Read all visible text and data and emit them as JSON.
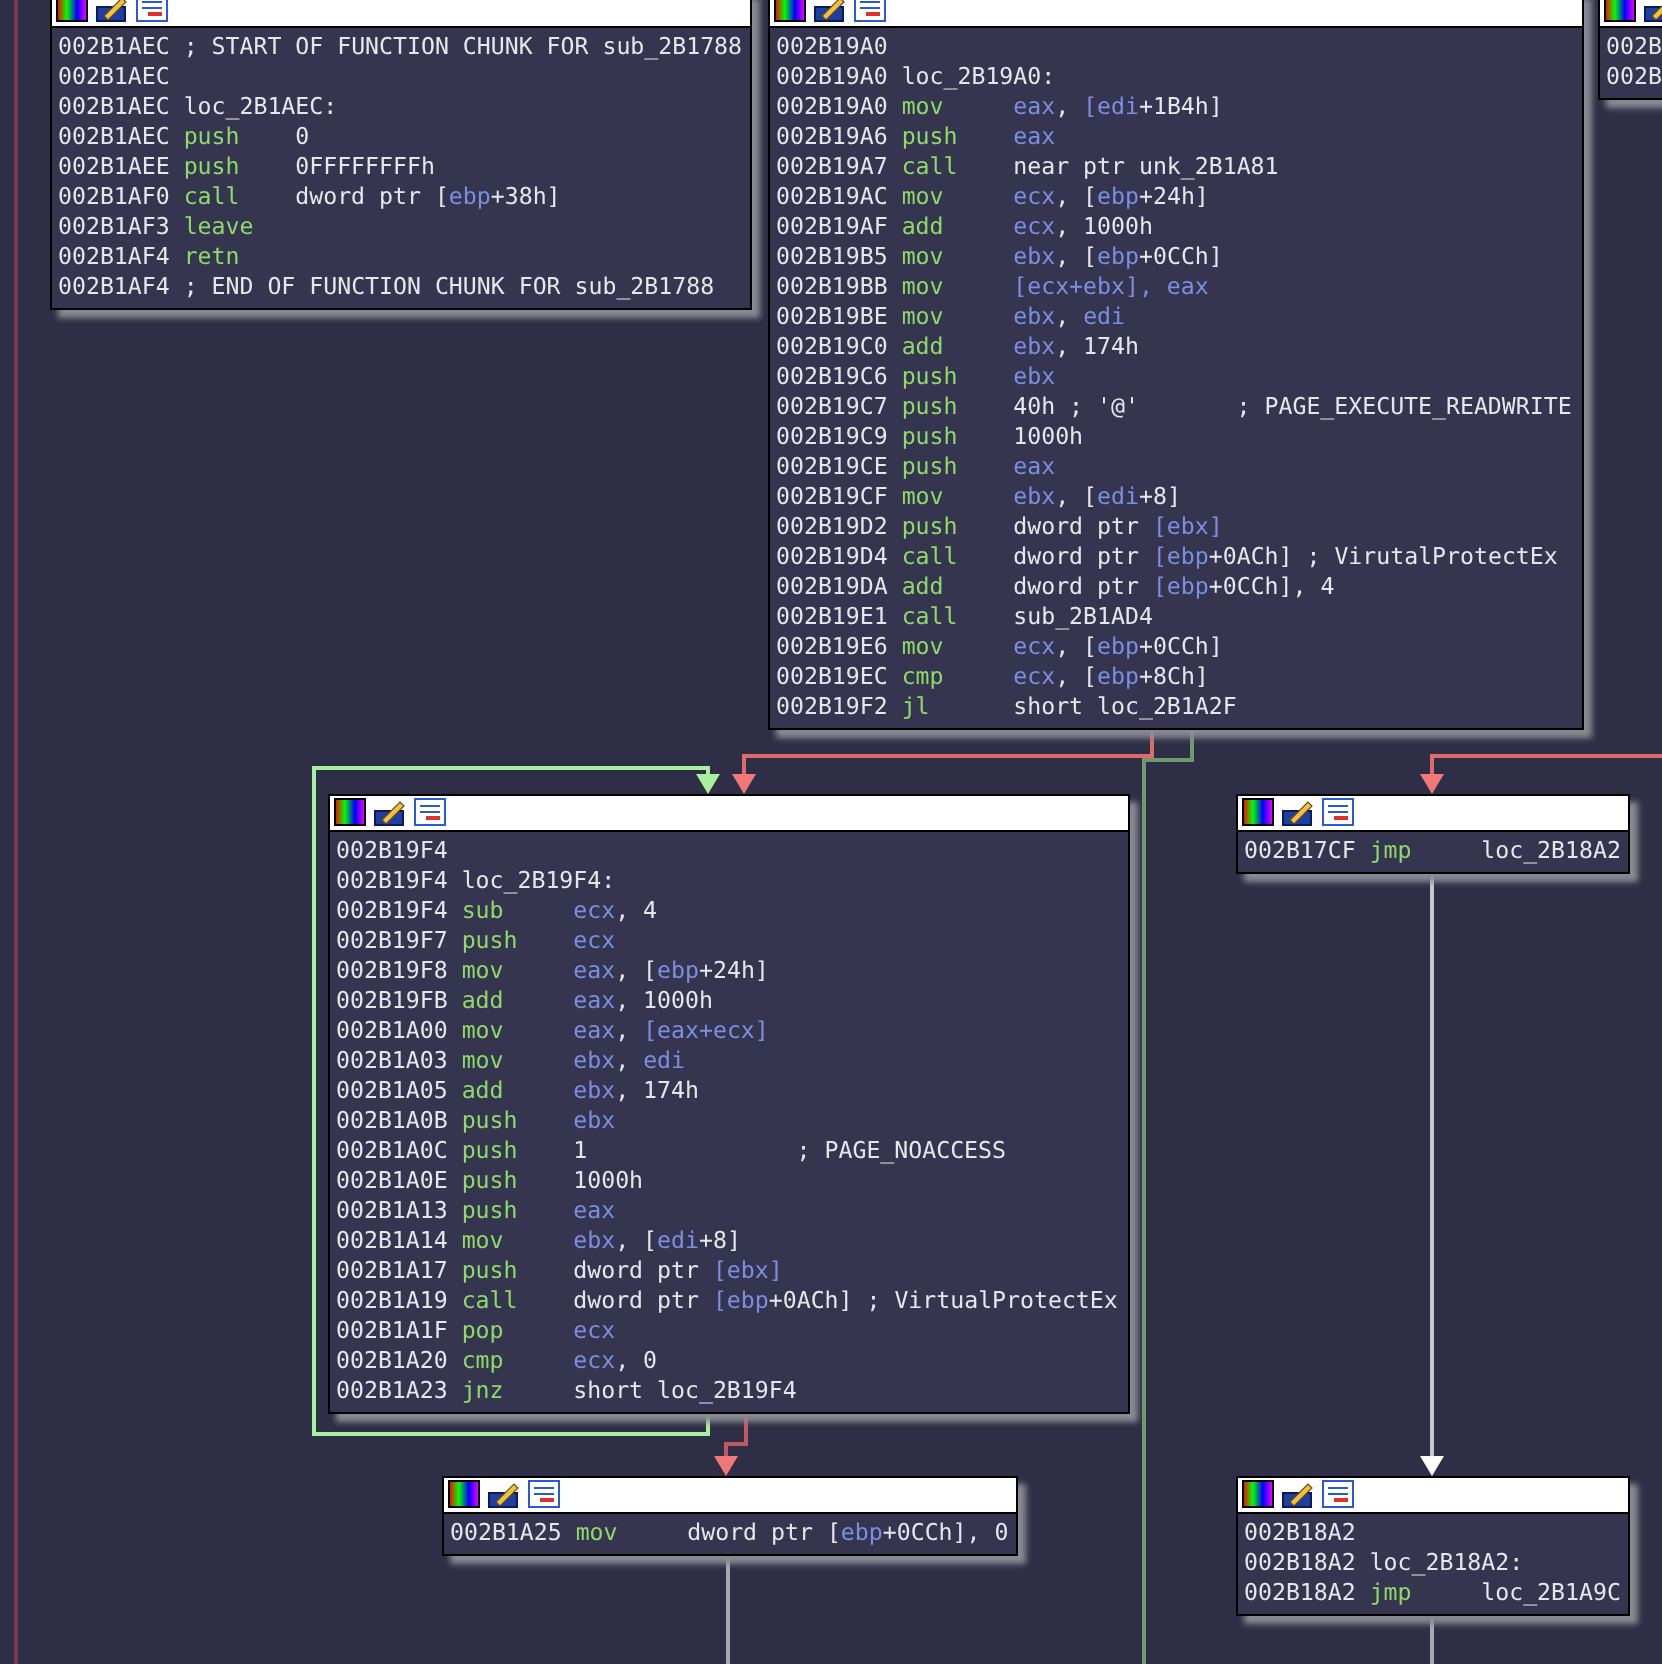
{
  "nodes": [
    {
      "lines": [
        {
          "kind": "comment",
          "addr": "002B1AEC",
          "text": "; START OF FUNCTION CHUNK FOR sub_2B1788"
        },
        {
          "kind": "blank",
          "addr": "002B1AEC"
        },
        {
          "kind": "label",
          "addr": "002B1AEC",
          "text": "loc_2B1AEC:"
        },
        {
          "kind": "insn",
          "addr": "002B1AEC",
          "mnemonic": "push",
          "ops": [
            {
              "txt": "0"
            }
          ]
        },
        {
          "kind": "insn",
          "addr": "002B1AEE",
          "mnemonic": "push",
          "ops": [
            {
              "txt": "0FFFFFFFFh"
            }
          ]
        },
        {
          "kind": "insn",
          "addr": "002B1AF0",
          "mnemonic": "call",
          "ops": [
            {
              "txt": "dword ptr ["
            },
            {
              "reg": "ebp"
            },
            {
              "txt": "+38h]"
            }
          ]
        },
        {
          "kind": "insn",
          "addr": "002B1AF3",
          "mnemonic": "leave"
        },
        {
          "kind": "insn",
          "addr": "002B1AF4",
          "mnemonic": "retn"
        },
        {
          "kind": "comment",
          "addr": "002B1AF4",
          "text": "; END OF FUNCTION CHUNK FOR sub_2B1788"
        }
      ]
    },
    {
      "lines": [
        {
          "kind": "blank",
          "addr": "002B19A0"
        },
        {
          "kind": "label",
          "addr": "002B19A0",
          "text": "loc_2B19A0:"
        },
        {
          "kind": "insn",
          "addr": "002B19A0",
          "mnemonic": "mov",
          "ops": [
            {
              "reg": "eax"
            },
            {
              "txt": ", "
            },
            {
              "reg": "[edi"
            },
            {
              "txt": "+1B4h]"
            }
          ]
        },
        {
          "kind": "insn",
          "addr": "002B19A6",
          "mnemonic": "push",
          "ops": [
            {
              "reg": "eax"
            }
          ]
        },
        {
          "kind": "insn",
          "addr": "002B19A7",
          "mnemonic": "call",
          "ops": [
            {
              "txt": "near ptr unk_2B1A81"
            }
          ]
        },
        {
          "kind": "insn",
          "addr": "002B19AC",
          "mnemonic": "mov",
          "ops": [
            {
              "reg": "ecx"
            },
            {
              "txt": ", ["
            },
            {
              "reg": "ebp"
            },
            {
              "txt": "+24h]"
            }
          ]
        },
        {
          "kind": "insn",
          "addr": "002B19AF",
          "mnemonic": "add",
          "ops": [
            {
              "reg": "ecx"
            },
            {
              "txt": ", 1000h"
            }
          ]
        },
        {
          "kind": "insn",
          "addr": "002B19B5",
          "mnemonic": "mov",
          "ops": [
            {
              "reg": "ebx"
            },
            {
              "txt": ", ["
            },
            {
              "reg": "ebp"
            },
            {
              "txt": "+0CCh]"
            }
          ]
        },
        {
          "kind": "insn",
          "addr": "002B19BB",
          "mnemonic": "mov",
          "ops": [
            {
              "reg": "[ecx+ebx], eax"
            }
          ]
        },
        {
          "kind": "insn",
          "addr": "002B19BE",
          "mnemonic": "mov",
          "ops": [
            {
              "reg": "ebx"
            },
            {
              "txt": ", "
            },
            {
              "reg": "edi"
            }
          ]
        },
        {
          "kind": "insn",
          "addr": "002B19C0",
          "mnemonic": "add",
          "ops": [
            {
              "reg": "ebx"
            },
            {
              "txt": ", 174h"
            }
          ]
        },
        {
          "kind": "insn",
          "addr": "002B19C6",
          "mnemonic": "push",
          "ops": [
            {
              "reg": "ebx"
            }
          ]
        },
        {
          "kind": "insn",
          "addr": "002B19C7",
          "mnemonic": "push",
          "ops": [
            {
              "txt": "40h ; '@'"
            }
          ],
          "comment": "; PAGE_EXECUTE_READWRITE"
        },
        {
          "kind": "insn",
          "addr": "002B19C9",
          "mnemonic": "push",
          "ops": [
            {
              "txt": "1000h"
            }
          ]
        },
        {
          "kind": "insn",
          "addr": "002B19CE",
          "mnemonic": "push",
          "ops": [
            {
              "reg": "eax"
            }
          ]
        },
        {
          "kind": "insn",
          "addr": "002B19CF",
          "mnemonic": "mov",
          "ops": [
            {
              "reg": "ebx"
            },
            {
              "txt": ", ["
            },
            {
              "reg": "edi"
            },
            {
              "txt": "+8]"
            }
          ]
        },
        {
          "kind": "insn",
          "addr": "002B19D2",
          "mnemonic": "push",
          "ops": [
            {
              "txt": "dword ptr "
            },
            {
              "reg": "[ebx]"
            }
          ]
        },
        {
          "kind": "insn",
          "addr": "002B19D4",
          "mnemonic": "call",
          "ops": [
            {
              "txt": "dword ptr "
            },
            {
              "reg": "[ebp"
            },
            {
              "txt": "+0ACh]"
            }
          ],
          "comment": "; VirutalProtectEx"
        },
        {
          "kind": "insn",
          "addr": "002B19DA",
          "mnemonic": "add",
          "ops": [
            {
              "txt": "dword ptr "
            },
            {
              "reg": "[ebp"
            },
            {
              "txt": "+0CCh], 4"
            }
          ]
        },
        {
          "kind": "insn",
          "addr": "002B19E1",
          "mnemonic": "call",
          "ops": [
            {
              "txt": "sub_2B1AD4"
            }
          ]
        },
        {
          "kind": "insn",
          "addr": "002B19E6",
          "mnemonic": "mov",
          "ops": [
            {
              "reg": "ecx"
            },
            {
              "txt": ", ["
            },
            {
              "reg": "ebp"
            },
            {
              "txt": "+0CCh]"
            }
          ]
        },
        {
          "kind": "insn",
          "addr": "002B19EC",
          "mnemonic": "cmp",
          "ops": [
            {
              "reg": "ecx"
            },
            {
              "txt": ", ["
            },
            {
              "reg": "ebp"
            },
            {
              "txt": "+8Ch]"
            }
          ]
        },
        {
          "kind": "insn",
          "addr": "002B19F2",
          "mnemonic": "jl",
          "ops": [
            {
              "txt": "short loc_2B1A2F"
            }
          ]
        }
      ]
    },
    {
      "lines": [
        {
          "kind": "blank",
          "addr": "002B"
        },
        {
          "kind": "blank",
          "addr": "002B"
        }
      ]
    },
    {
      "lines": [
        {
          "kind": "blank",
          "addr": "002B19F4"
        },
        {
          "kind": "label",
          "addr": "002B19F4",
          "text": "loc_2B19F4:"
        },
        {
          "kind": "insn",
          "addr": "002B19F4",
          "mnemonic": "sub",
          "ops": [
            {
              "reg": "ecx"
            },
            {
              "txt": ", 4"
            }
          ]
        },
        {
          "kind": "insn",
          "addr": "002B19F7",
          "mnemonic": "push",
          "ops": [
            {
              "reg": "ecx"
            }
          ]
        },
        {
          "kind": "insn",
          "addr": "002B19F8",
          "mnemonic": "mov",
          "ops": [
            {
              "reg": "eax"
            },
            {
              "txt": ", ["
            },
            {
              "reg": "ebp"
            },
            {
              "txt": "+24h]"
            }
          ]
        },
        {
          "kind": "insn",
          "addr": "002B19FB",
          "mnemonic": "add",
          "ops": [
            {
              "reg": "eax"
            },
            {
              "txt": ", 1000h"
            }
          ]
        },
        {
          "kind": "insn",
          "addr": "002B1A00",
          "mnemonic": "mov",
          "ops": [
            {
              "reg": "eax"
            },
            {
              "txt": ", "
            },
            {
              "reg": "[eax+ecx]"
            }
          ]
        },
        {
          "kind": "insn",
          "addr": "002B1A03",
          "mnemonic": "mov",
          "ops": [
            {
              "reg": "ebx"
            },
            {
              "txt": ", "
            },
            {
              "reg": "edi"
            }
          ]
        },
        {
          "kind": "insn",
          "addr": "002B1A05",
          "mnemonic": "add",
          "ops": [
            {
              "reg": "ebx"
            },
            {
              "txt": ", 174h"
            }
          ]
        },
        {
          "kind": "insn",
          "addr": "002B1A0B",
          "mnemonic": "push",
          "ops": [
            {
              "reg": "ebx"
            }
          ]
        },
        {
          "kind": "insn",
          "addr": "002B1A0C",
          "mnemonic": "push",
          "ops": [
            {
              "txt": "1"
            }
          ],
          "comment": "; PAGE_NOACCESS"
        },
        {
          "kind": "insn",
          "addr": "002B1A0E",
          "mnemonic": "push",
          "ops": [
            {
              "txt": "1000h"
            }
          ]
        },
        {
          "kind": "insn",
          "addr": "002B1A13",
          "mnemonic": "push",
          "ops": [
            {
              "reg": "eax"
            }
          ]
        },
        {
          "kind": "insn",
          "addr": "002B1A14",
          "mnemonic": "mov",
          "ops": [
            {
              "reg": "ebx"
            },
            {
              "txt": ", ["
            },
            {
              "reg": "edi"
            },
            {
              "txt": "+8]"
            }
          ]
        },
        {
          "kind": "insn",
          "addr": "002B1A17",
          "mnemonic": "push",
          "ops": [
            {
              "txt": "dword ptr "
            },
            {
              "reg": "[ebx]"
            }
          ]
        },
        {
          "kind": "insn",
          "addr": "002B1A19",
          "mnemonic": "call",
          "ops": [
            {
              "txt": "dword ptr "
            },
            {
              "reg": "[ebp"
            },
            {
              "txt": "+0ACh]"
            }
          ],
          "comment": "; VirtualProtectEx"
        },
        {
          "kind": "insn",
          "addr": "002B1A1F",
          "mnemonic": "pop",
          "ops": [
            {
              "reg": "ecx"
            }
          ]
        },
        {
          "kind": "insn",
          "addr": "002B1A20",
          "mnemonic": "cmp",
          "ops": [
            {
              "reg": "ecx"
            },
            {
              "txt": ", 0"
            }
          ]
        },
        {
          "kind": "insn",
          "addr": "002B1A23",
          "mnemonic": "jnz",
          "ops": [
            {
              "txt": "short loc_2B19F4"
            }
          ]
        }
      ]
    },
    {
      "lines": [
        {
          "kind": "insn",
          "addr": "002B17CF",
          "mnemonic": "jmp",
          "ops": [
            {
              "txt": "loc_2B18A2"
            }
          ]
        }
      ]
    },
    {
      "lines": [
        {
          "kind": "insn",
          "addr": "002B1A25",
          "mnemonic": "mov",
          "ops": [
            {
              "txt": "dword ptr ["
            },
            {
              "reg": "ebp"
            },
            {
              "txt": "+0CCh], 0"
            }
          ]
        }
      ]
    },
    {
      "lines": [
        {
          "kind": "blank",
          "addr": "002B18A2"
        },
        {
          "kind": "label",
          "addr": "002B18A2",
          "text": "loc_2B18A2:"
        },
        {
          "kind": "insn",
          "addr": "002B18A2",
          "mnemonic": "jmp",
          "ops": [
            {
              "txt": "loc_2B1A9C"
            }
          ]
        }
      ]
    }
  ]
}
